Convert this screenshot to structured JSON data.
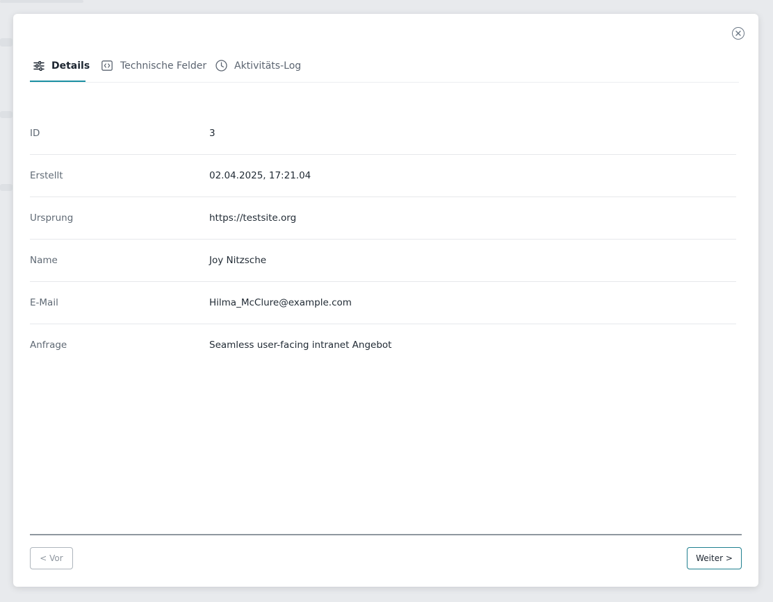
{
  "tabs": [
    {
      "label": "Details",
      "icon": "sliders-icon",
      "active": true
    },
    {
      "label": "Technische Felder",
      "icon": "code-icon",
      "active": false
    },
    {
      "label": "Aktivitäts-Log",
      "icon": "clock-icon",
      "active": false
    }
  ],
  "fields": [
    {
      "label": "ID",
      "value": "3"
    },
    {
      "label": "Erstellt",
      "value": "02.04.2025, 17:21.04"
    },
    {
      "label": "Ursprung",
      "value": "https://testsite.org"
    },
    {
      "label": "Name",
      "value": "Joy Nitzsche"
    },
    {
      "label": "E-Mail",
      "value": "Hilma_McClure@example.com"
    },
    {
      "label": "Anfrage",
      "value": "Seamless user-facing intranet Angebot"
    }
  ],
  "footer": {
    "prev_label": "< Vor",
    "next_label": "Weiter >"
  },
  "colors": {
    "accent": "#1a8fa3",
    "text": "#1f2933",
    "muted": "#5f6974"
  }
}
